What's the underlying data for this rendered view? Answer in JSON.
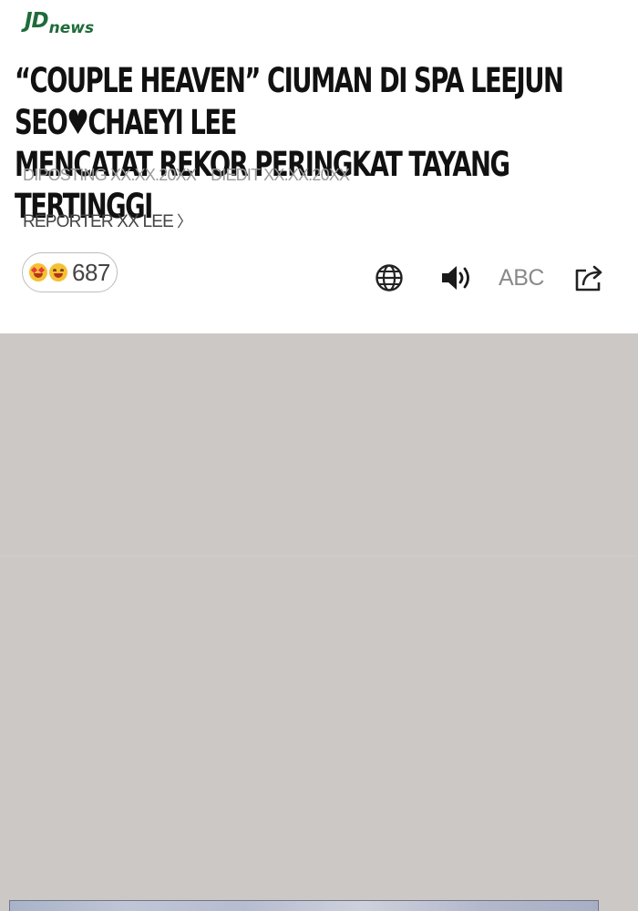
{
  "brand": {
    "logo_main": "JD",
    "logo_sub": "news",
    "color": "#1f6b3a"
  },
  "article": {
    "headline_line1": "“COUPLE HEAVEN” CIUMAN DI SPA LEEJUN SEO♥CHAEYI LEE",
    "headline_line2": "MENCATAT REKOR PERINGKAT TAYANG TERTINGGI",
    "posted": "DIPOSTING XX.XX.20XX",
    "edited": "DIEDIT XX.XX.20XX",
    "reporter": "REPORTER XX LEE",
    "reporter_chevron": "〉"
  },
  "reactions": {
    "emojis": [
      "heart-eyes-emoji",
      "laughing-emoji"
    ],
    "count": "687"
  },
  "toolbar": {
    "translate_icon": "globe-icon",
    "audio_icon": "speaker-icon",
    "font_size_label": "ABC",
    "share_icon": "share-icon"
  },
  "colors": {
    "headline": "#111111",
    "meta_text": "#9a9a9a",
    "image_placeholder": "#cbc8c5"
  }
}
